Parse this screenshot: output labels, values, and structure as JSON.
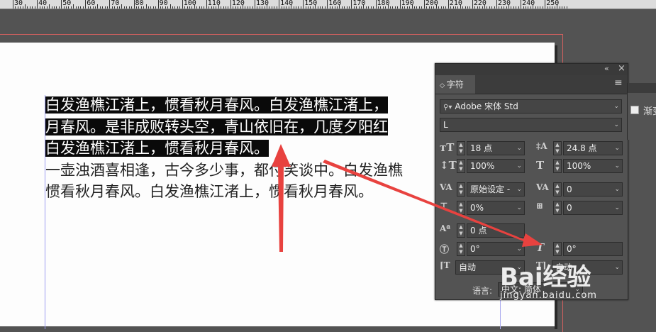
{
  "ruler": {
    "marks": [
      "30",
      "40",
      "50",
      "60",
      "70",
      "80",
      "90",
      "100",
      "110",
      "120",
      "130",
      "140",
      "150",
      "160",
      "170",
      "180",
      "190",
      "200",
      "210",
      "220",
      "230",
      "240",
      "250"
    ]
  },
  "document": {
    "lines": [
      {
        "parts": [
          {
            "text": "白发渔樵江渚上，惯看秋月春风。白发渔樵江渚上，",
            "selected": true
          }
        ]
      },
      {
        "parts": [
          {
            "text": "月春风。是非成败转头空，青山依旧在，几度夕阳红",
            "selected": true
          }
        ]
      },
      {
        "parts": [
          {
            "text": "白发渔樵江渚上，惯看秋月春风。",
            "selected": true
          }
        ]
      },
      {
        "parts": [
          {
            "text": "一壶浊酒喜相逢，古今多少事，都付笑谈中。白发渔樵",
            "selected": false
          }
        ]
      },
      {
        "parts": [
          {
            "text": "惯看秋月春风。白发渔樵江渚上，惯看秋月春风。",
            "selected": false
          }
        ]
      }
    ]
  },
  "panel": {
    "collapse_icon": "«",
    "close_icon": "×",
    "tab_icon": "◇",
    "tab_label": "字符",
    "menu_icon": "≡",
    "font_family": "Adobe 宋体 Std",
    "font_style": "L",
    "font_size": "18 点",
    "leading": "24.8 点",
    "vertical_scale": "100%",
    "horizontal_scale": "100%",
    "kerning": "原始设定 -",
    "tracking": "0",
    "tsume": "0%",
    "grid_spacing": "0",
    "baseline_shift": "0 点",
    "char_rotation": "0°",
    "skew": "0°",
    "aki_before": "自动",
    "aki_after": "自动",
    "language_label": "语言:",
    "language_value": "中文: 简体"
  },
  "side_panel": {
    "label": "渐变"
  },
  "watermark": {
    "logo": "Bai经验",
    "url": "jingyan.baidu.com"
  },
  "colors": {
    "selection": "#0a0a0a",
    "arrow": "#e8423f",
    "bleed": "#d2605f"
  }
}
